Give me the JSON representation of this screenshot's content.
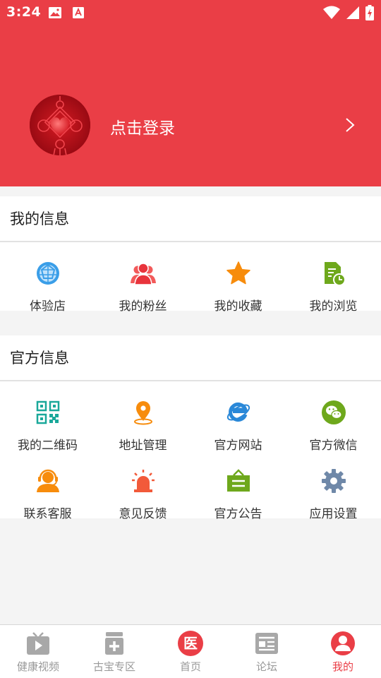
{
  "status_bar": {
    "time": "3:24"
  },
  "profile": {
    "login_label": "点击登录"
  },
  "my_info": {
    "title": "我的信息",
    "items": [
      {
        "label": "体验店",
        "icon": "globe-icon"
      },
      {
        "label": "我的粉丝",
        "icon": "fans-icon"
      },
      {
        "label": "我的收藏",
        "icon": "star-icon"
      },
      {
        "label": "我的浏览",
        "icon": "history-icon"
      }
    ]
  },
  "official_info": {
    "title": "官方信息",
    "items": [
      {
        "label": "我的二维码",
        "icon": "qr-code-icon"
      },
      {
        "label": "地址管理",
        "icon": "location-pin-icon"
      },
      {
        "label": "官方网站",
        "icon": "ie-browser-icon"
      },
      {
        "label": "官方微信",
        "icon": "wechat-icon"
      },
      {
        "label": "联系客服",
        "icon": "customer-service-icon"
      },
      {
        "label": "意见反馈",
        "icon": "alarm-light-icon"
      },
      {
        "label": "官方公告",
        "icon": "announcement-icon"
      },
      {
        "label": "应用设置",
        "icon": "gear-icon"
      }
    ]
  },
  "tabbar": {
    "tabs": [
      {
        "label": "健康视频",
        "icon": "tv-icon"
      },
      {
        "label": "古宝专区",
        "icon": "medicine-box-icon"
      },
      {
        "label": "首页",
        "icon": "medical-home-icon",
        "glyph": "医"
      },
      {
        "label": "论坛",
        "icon": "forum-icon"
      },
      {
        "label": "我的",
        "icon": "user-icon",
        "active": true
      }
    ]
  },
  "colors": {
    "brand_red": "#ea3e46",
    "blue": "#3a9ee8",
    "orange": "#f78c0c",
    "green": "#6ea81c",
    "teal": "#1aa89a",
    "gear_blue": "#6f88a8"
  }
}
